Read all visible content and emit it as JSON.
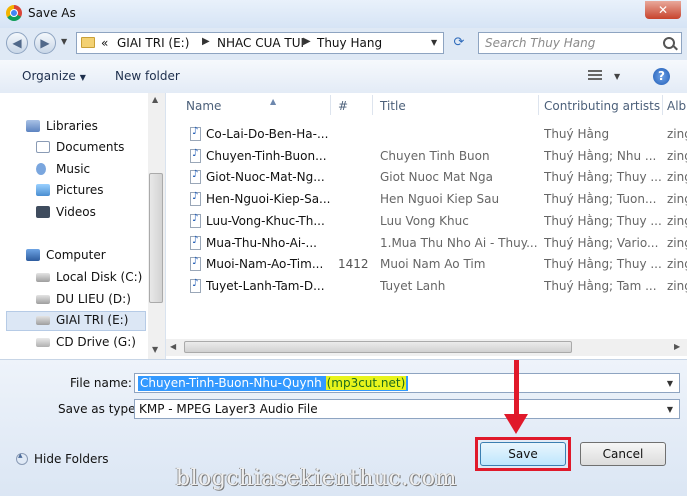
{
  "window": {
    "title": "Save As",
    "close_symbol": "✕"
  },
  "address": {
    "overflow": "«",
    "crumbs": [
      "GIAI TRI (E:)",
      "NHAC CUA TUI",
      "Thuy Hang"
    ],
    "search_placeholder": "Search Thuy Hang"
  },
  "toolbar": {
    "organize": "Organize",
    "new_folder": "New folder",
    "help": "?"
  },
  "nav": {
    "libraries": "Libraries",
    "documents": "Documents",
    "music": "Music",
    "pictures": "Pictures",
    "videos": "Videos",
    "computer": "Computer",
    "local_disk": "Local Disk (C:)",
    "du_lieu": "DU LIEU (D:)",
    "giai_tri": "GIAI TRI (E:)",
    "cd_drive": "CD Drive (G:)"
  },
  "columns": {
    "name": "Name",
    "number": "#",
    "title": "Title",
    "artists": "Contributing artists",
    "album": "Albu"
  },
  "files": [
    {
      "name": "Co-Lai-Do-Ben-Ha-...",
      "number": "",
      "title": "",
      "artists": "Thuý Hằng",
      "album": "zing"
    },
    {
      "name": "Chuyen-Tinh-Buon...",
      "number": "",
      "title": "Chuyen Tinh Buon",
      "artists": "Thuý Hằng; Nhu ...",
      "album": "zing"
    },
    {
      "name": "Giot-Nuoc-Mat-Ng...",
      "number": "",
      "title": "Giot Nuoc Mat Nga",
      "artists": "Thuý Hằng; Thuy ...",
      "album": "zing"
    },
    {
      "name": "Hen-Nguoi-Kiep-Sa...",
      "number": "",
      "title": "Hen Nguoi Kiep Sau",
      "artists": "Thuý Hằng; Tuon...",
      "album": "zing"
    },
    {
      "name": "Luu-Vong-Khuc-Th...",
      "number": "",
      "title": "Luu Vong Khuc",
      "artists": "Thuý Hằng; Thuy ...",
      "album": "zing"
    },
    {
      "name": "Mua-Thu-Nho-Ai-...",
      "number": "",
      "title": "1.Mua Thu Nho Ai - Thuy...",
      "artists": "Thuý Hằng; Vario...",
      "album": "zing"
    },
    {
      "name": "Muoi-Nam-Ao-Tim...",
      "number": "1412",
      "title": "Muoi Nam Ao Tim",
      "artists": "Thuý Hằng; Thuy ...",
      "album": "zing"
    },
    {
      "name": "Tuyet-Lanh-Tam-D...",
      "number": "",
      "title": "Tuyet Lanh",
      "artists": "Thuý Hằng; Tam ...",
      "album": "zing"
    }
  ],
  "form": {
    "file_name_label": "File name:",
    "file_name_main": "Chuyen-Tinh-Buon-Nhu-Quynh ",
    "file_name_highlight": "(mp3cut.net)",
    "save_type_label": "Save as type:",
    "save_type_value": "KMP - MPEG Layer3 Audio File",
    "hide_folders": "Hide Folders",
    "save_label": "Save",
    "cancel_label": "Cancel"
  },
  "watermark": "blogchiasekienthuc.com"
}
